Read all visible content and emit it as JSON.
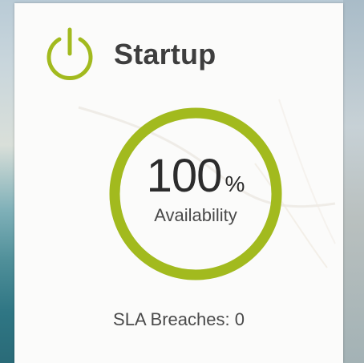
{
  "widget": {
    "title": "Startup",
    "icon": "power-icon",
    "accent_color": "#a2ba1e",
    "availability": {
      "value": "100",
      "unit": "%",
      "label": "Availability",
      "fill_fraction": 1.0
    },
    "sla": {
      "text": "SLA Breaches: 0"
    }
  }
}
